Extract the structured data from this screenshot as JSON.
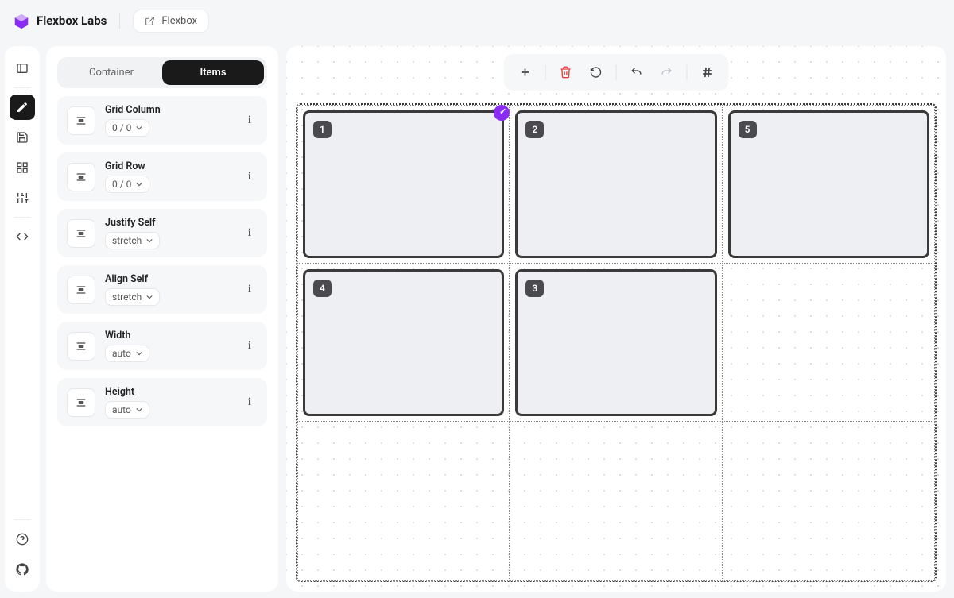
{
  "header": {
    "brand": "Flexbox Labs",
    "link_label": "Flexbox"
  },
  "rail": {
    "items": [
      "panel-toggle",
      "edit",
      "save",
      "layouts",
      "settings",
      "code"
    ],
    "bottom": [
      "help",
      "github"
    ],
    "active": "edit"
  },
  "panel": {
    "tabs": {
      "container": "Container",
      "items": "Items",
      "active": "items"
    },
    "properties": [
      {
        "key": "grid-column",
        "label": "Grid Column",
        "value": "0 / 0"
      },
      {
        "key": "grid-row",
        "label": "Grid Row",
        "value": "0 / 0"
      },
      {
        "key": "justify-self",
        "label": "Justify Self",
        "value": "stretch"
      },
      {
        "key": "align-self",
        "label": "Align Self",
        "value": "stretch"
      },
      {
        "key": "width",
        "label": "Width",
        "value": "auto"
      },
      {
        "key": "height",
        "label": "Height",
        "value": "auto"
      }
    ]
  },
  "toolbar": {
    "buttons": [
      "add",
      "delete",
      "reset",
      "undo",
      "redo",
      "snap"
    ]
  },
  "grid": {
    "columns": 3,
    "rows": 3,
    "items": [
      {
        "id": "1",
        "col": 1,
        "row": 1,
        "selected": true
      },
      {
        "id": "2",
        "col": 2,
        "row": 1,
        "selected": false
      },
      {
        "id": "5",
        "col": 3,
        "row": 1,
        "selected": false
      },
      {
        "id": "4",
        "col": 1,
        "row": 2,
        "selected": false
      },
      {
        "id": "3",
        "col": 2,
        "row": 2,
        "selected": false
      }
    ]
  },
  "colors": {
    "accent": "#8b2cf5",
    "danger": "#e53e3e",
    "ink": "#1a1a1a"
  }
}
